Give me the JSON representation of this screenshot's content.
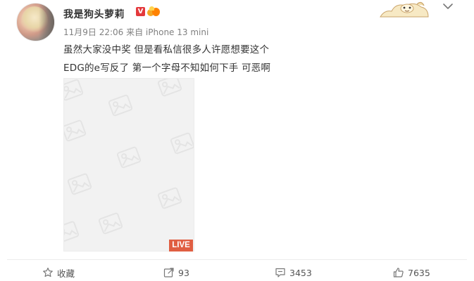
{
  "post": {
    "username": "我是狗头萝莉",
    "verified_badge": "V",
    "meta": "11月9日 22:06 来自 iPhone 13 mini",
    "text_line1": "虽然大家没中奖 但是看私信很多人许愿想要这个",
    "text_line2": "EDG的e写反了 第一个字母不知如何下手 可恶啊",
    "media_badge": "LIVE"
  },
  "actions": {
    "favorite": {
      "label": "收藏",
      "icon": "star-icon"
    },
    "repost": {
      "count": "93",
      "icon": "repost-icon"
    },
    "comment": {
      "count": "3453",
      "icon": "comment-icon"
    },
    "like": {
      "count": "7635",
      "icon": "thumbs-up-icon"
    }
  },
  "colors": {
    "live_badge": "#e05e42",
    "verified_badge": "#e4393c",
    "meta_text": "#808080",
    "media_placeholder": "#f2f2f2"
  }
}
